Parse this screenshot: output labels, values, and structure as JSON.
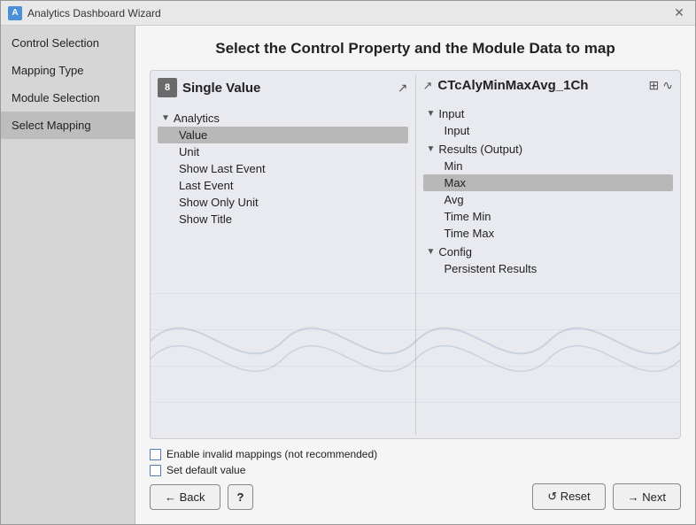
{
  "window": {
    "title": "Analytics Dashboard Wizard",
    "close_label": "✕"
  },
  "sidebar": {
    "items": [
      {
        "label": "Control Selection",
        "active": false
      },
      {
        "label": "Mapping Type",
        "active": false
      },
      {
        "label": "Module Selection",
        "active": false
      },
      {
        "label": "Select Mapping",
        "active": true
      }
    ]
  },
  "main": {
    "title": "Select the Control Property and the Module Data to map",
    "left_panel": {
      "icon_label": "8",
      "title": "Single Value",
      "icon_link": "↗",
      "icon_manage": "⊞",
      "icon_wave": "∿",
      "tree": {
        "groups": [
          {
            "label": "Analytics",
            "expanded": true,
            "items": [
              {
                "label": "Value",
                "selected": true
              },
              {
                "label": "Unit",
                "selected": false
              },
              {
                "label": "Show Last Event",
                "selected": false
              },
              {
                "label": "Last Event",
                "selected": false
              },
              {
                "label": "Show Only Unit",
                "selected": false
              },
              {
                "label": "Show Title",
                "selected": false
              }
            ]
          }
        ]
      }
    },
    "right_panel": {
      "icon_link": "↗",
      "title": "CTcAlyMinMaxAvg_1Ch",
      "icon_manage": "⊞",
      "icon_wave": "∿",
      "tree": {
        "groups": [
          {
            "label": "Input",
            "expanded": true,
            "items": [
              {
                "label": "Input",
                "selected": false
              }
            ]
          },
          {
            "label": "Results (Output)",
            "expanded": true,
            "items": [
              {
                "label": "Min",
                "selected": false
              },
              {
                "label": "Max",
                "selected": true
              },
              {
                "label": "Avg",
                "selected": false
              },
              {
                "label": "Time Min",
                "selected": false
              },
              {
                "label": "Time Max",
                "selected": false
              }
            ]
          },
          {
            "label": "Config",
            "expanded": true,
            "items": [
              {
                "label": "Persistent Results",
                "selected": false
              }
            ]
          }
        ]
      }
    }
  },
  "footer": {
    "checkbox1_label": "Enable invalid mappings (not recommended)",
    "checkbox2_label": "Set default value",
    "back_label": "← Back",
    "help_label": "?",
    "reset_label": "↺  Reset",
    "next_label": "→ Next"
  }
}
